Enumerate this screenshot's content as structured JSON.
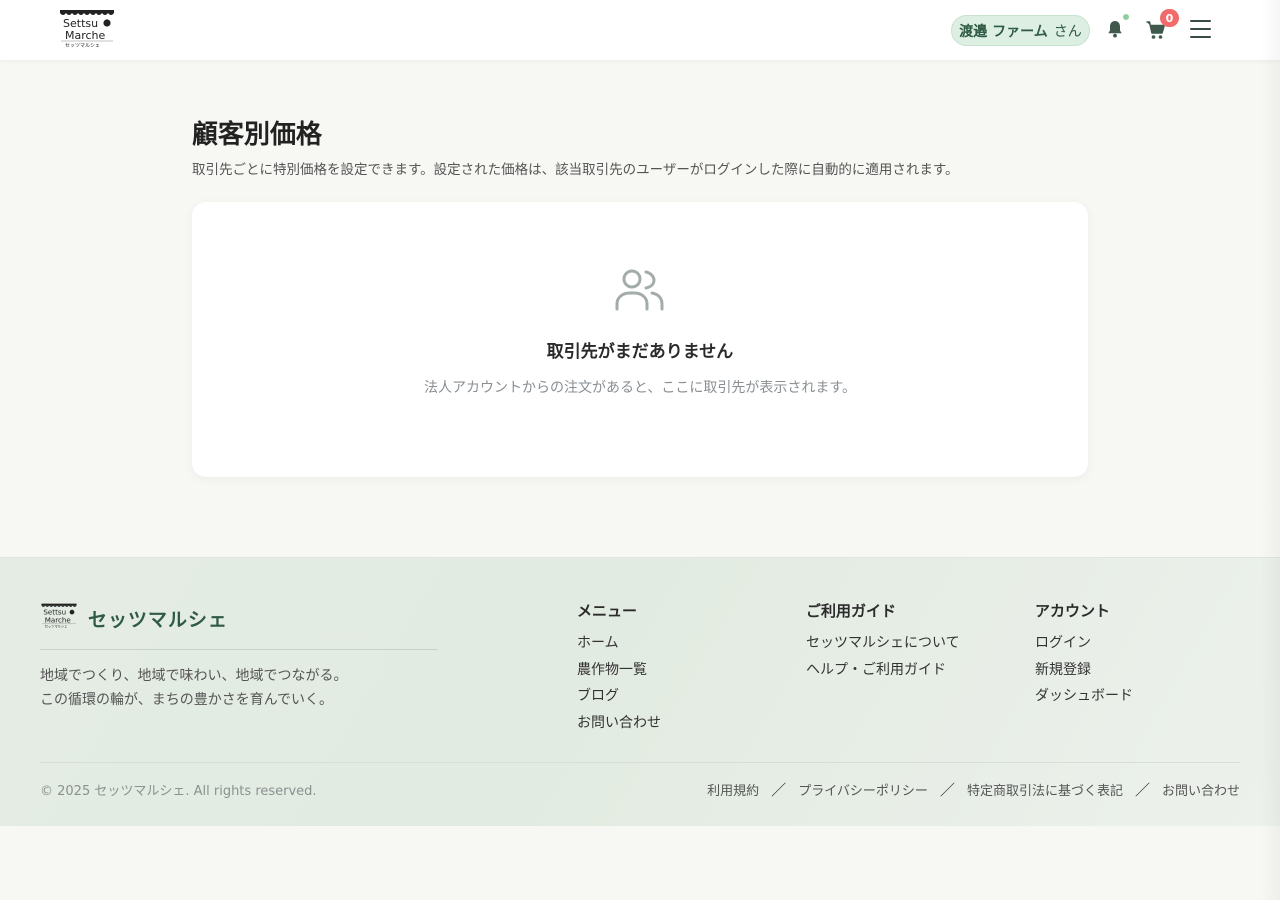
{
  "header": {
    "logo_text_top": "Settsu",
    "logo_text_bottom": "Marche",
    "logo_text_kana": "セッツマルシェ",
    "user_name": "渡邉 ファーム",
    "user_suffix": "さん",
    "cart_count": "0"
  },
  "main": {
    "title": "顧客別価格",
    "description": "取引先ごとに特別価格を設定できます。設定された価格は、該当取引先のユーザーがログインした際に自動的に適用されます。",
    "empty_title": "取引先がまだありません",
    "empty_description": "法人アカウントからの注文があると、ここに取引先が表示されます。"
  },
  "footer": {
    "brand": "セッツマルシェ",
    "tagline_1": "地域でつくり、地域で味わい、地域でつながる。",
    "tagline_2": "この循環の輪が、まちの豊かさを育んでいく。",
    "menu": {
      "heading": "メニュー",
      "items": [
        "ホーム",
        "農作物一覧",
        "ブログ",
        "お問い合わせ"
      ]
    },
    "guide": {
      "heading": "ご利用ガイド",
      "items": [
        "セッツマルシェについて",
        "ヘルプ・ご利用ガイド"
      ]
    },
    "account": {
      "heading": "アカウント",
      "items": [
        "ログイン",
        "新規登録",
        "ダッシュボード"
      ]
    },
    "copyright": "© 2025 セッツマルシェ. All rights reserved.",
    "legal": [
      "利用規約",
      "プライバシーポリシー",
      "特定商取引法に基づく表記",
      "お問い合わせ"
    ],
    "legal_separator": "／"
  },
  "colors": {
    "accent": "#2f5a43",
    "pill_bg": "#dcefe2",
    "badge": "#f26b6b",
    "page_bg": "#f7f8f4"
  },
  "icons": {
    "notification": "bell-icon",
    "cart": "cart-icon",
    "menu": "hamburger-icon",
    "empty_state": "users-icon"
  }
}
